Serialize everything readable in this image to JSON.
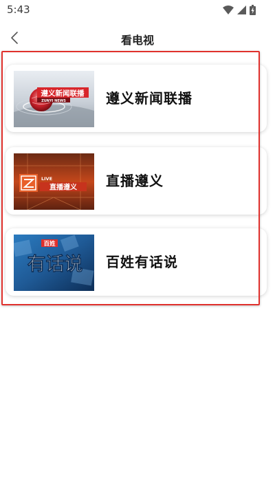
{
  "status_bar": {
    "time": "5:43",
    "icons": [
      "wifi-icon",
      "signal-icon",
      "battery-icon"
    ]
  },
  "header": {
    "back_icon": "chevron-left-icon",
    "title": "看电视"
  },
  "channels": [
    {
      "title": "遵义新闻联播",
      "thumb_caption": "遵义新闻联播",
      "thumb_subcaption": "ZUNYI NEWS"
    },
    {
      "title": "直播遵义",
      "thumb_badge": "LIVE",
      "thumb_caption": "直播遵义"
    },
    {
      "title": "百姓有话说",
      "thumb_caption_small": "百姓",
      "thumb_caption_large": "有话说"
    }
  ],
  "colors": {
    "highlight_border": "#e0302c",
    "accent_red": "#d8262b",
    "accent_orange": "#e8602a",
    "accent_blue": "#1f5a96"
  }
}
